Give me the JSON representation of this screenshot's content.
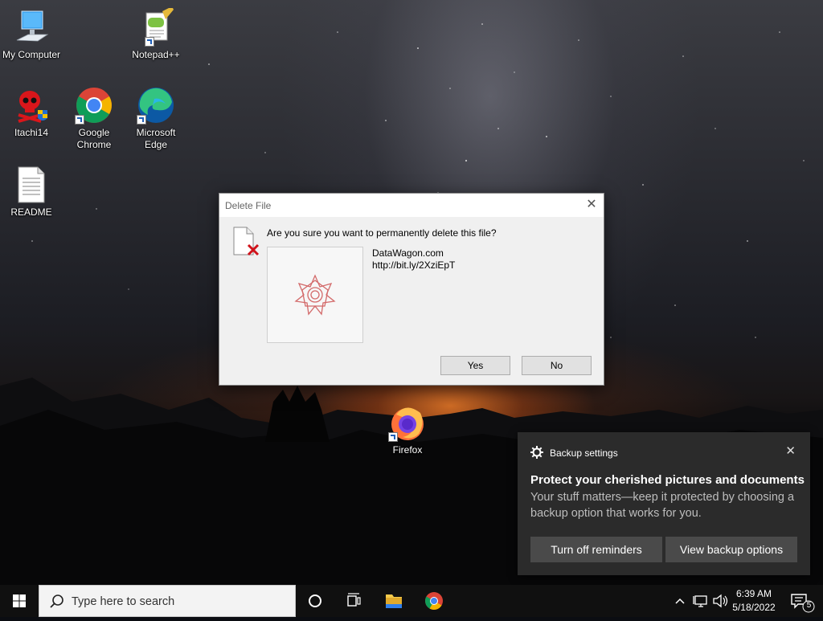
{
  "desktop": {
    "icons": [
      {
        "label": "My Computer"
      },
      {
        "label": "Notepad++"
      },
      {
        "label": "Itachi14"
      },
      {
        "label": "Google\nChrome",
        "line1": "Google",
        "line2": "Chrome"
      },
      {
        "label": "Microsoft Edge",
        "line1": "Microsoft",
        "line2": "Edge"
      },
      {
        "label": "README"
      },
      {
        "label": "Firefox"
      }
    ]
  },
  "dialog": {
    "title": "Delete File",
    "close_glyph": "✕",
    "question": "Are you sure you want to permanently delete this file?",
    "file_name": "DataWagon.com",
    "file_link": "http://bit.ly/2XziEpT",
    "yes_label": "Yes",
    "no_label": "No"
  },
  "toast": {
    "app_name": "Backup settings",
    "close_glyph": "✕",
    "title": "Protect your cherished pictures and documents",
    "body": "Your stuff matters—keep it protected by choosing a backup option that works for you.",
    "btn_turn_off": "Turn off reminders",
    "btn_view": "View backup options"
  },
  "taskbar": {
    "search_placeholder": "Type here to search",
    "time": "6:39 AM",
    "date": "5/18/2022",
    "notification_count": "5"
  },
  "colors": {
    "dialog_bg": "#f0f0f0",
    "toast_bg": "#2b2b2b",
    "taskbar_bg": "#101010",
    "delete_x": "#d0121a"
  }
}
